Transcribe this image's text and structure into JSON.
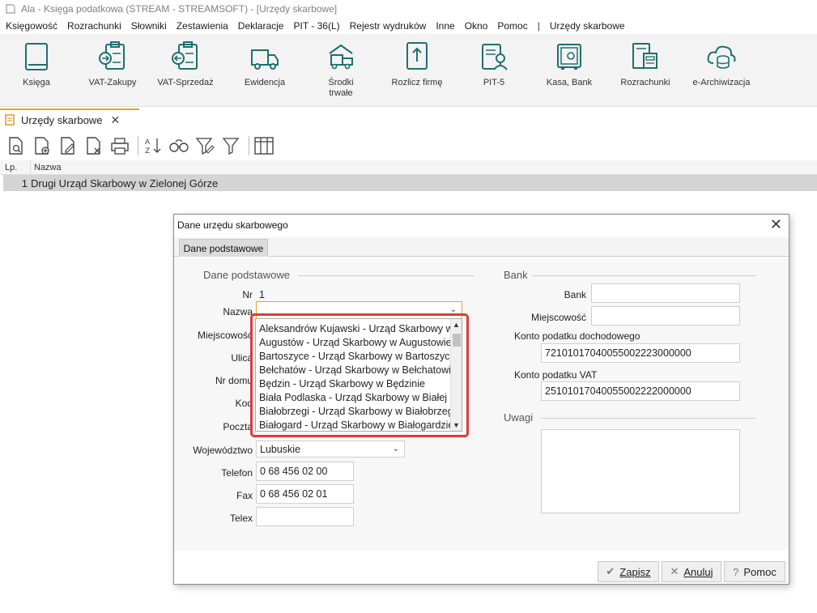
{
  "window": {
    "title": "Ala - Księga podatkowa (STREAM - STREAMSOFT) - [Urzędy skarbowe]"
  },
  "menu": [
    "Księgowość",
    "Rozrachunki",
    "Słowniki",
    "Zestawienia",
    "Deklaracje",
    "PIT - 36(L)",
    "Rejestr wydruków",
    "Inne",
    "Okno",
    "Pomoc",
    "|",
    "Urzędy skarbowe"
  ],
  "ribbon": [
    {
      "label": "Księga",
      "icon": "book-icon"
    },
    {
      "label": "VAT-Zakupy",
      "icon": "vat-purchase-icon"
    },
    {
      "label": "VAT-Sprzedaż",
      "icon": "vat-sales-icon"
    },
    {
      "label": "Ewidencja",
      "icon": "truck-icon"
    },
    {
      "label": "Środki trwałe",
      "icon": "fixed-assets-icon"
    },
    {
      "label": "Rozlicz firmę",
      "icon": "upload-document-icon"
    },
    {
      "label": "PIT-5",
      "icon": "person-document-icon"
    },
    {
      "label": "Kasa, Bank",
      "icon": "safe-icon"
    },
    {
      "label": "Rozrachunki",
      "icon": "settlements-icon"
    },
    {
      "label": "e-Archiwizacja",
      "icon": "cloud-database-icon"
    }
  ],
  "doc_tab": {
    "label": "Urzędy skarbowe",
    "close": "✕"
  },
  "grid": {
    "headers": {
      "lp": "Lp.",
      "name": "Nazwa"
    },
    "rows": [
      {
        "lp": "1",
        "name": "Drugi Urząd Skarbowy w Zielonej Górze"
      }
    ]
  },
  "dialog": {
    "title": "Dane urzędu skarbowego",
    "close": "✕",
    "tab": "Dane podstawowe",
    "left_group": "Dane podstawowe",
    "right_group": "Bank",
    "notes_group": "Uwagi",
    "labels": {
      "nr": "Nr",
      "nazwa": "Nazwa",
      "miejscowosc": "Miejscowość",
      "ulica": "Ulica",
      "nr_domu": "Nr domu",
      "kod": "Kod",
      "poczta": "Poczta",
      "wojewodztwo": "Województwo",
      "telefon": "Telefon",
      "fax": "Fax",
      "telex": "Telex",
      "bank": "Bank",
      "bank_miejscowosc": "Miejscowość",
      "konto_doch": "Konto podatku dochodowego",
      "konto_vat": "Konto podatku VAT"
    },
    "values": {
      "nr": "1",
      "nazwa": "",
      "wojewodztwo": "Lubuskie",
      "telefon": "0 68 456 02 00",
      "fax": "0 68 456 02 01",
      "telex": "",
      "bank": "",
      "bank_miejscowosc": "",
      "konto_doch": "72101017040055002223000000",
      "konto_vat": "25101017040055002222000000"
    },
    "dropdown_items": [
      "Aleksandrów Kujawski - Urząd Skarbowy w Aleksandrowie Kujawskim",
      "Augustów - Urząd Skarbowy w Augustowie",
      "Bartoszyce - Urząd Skarbowy w Bartoszycach",
      "Bełchatów - Urząd Skarbowy w Bełchatowie",
      "Będzin - Urząd Skarbowy w Będzinie",
      "Biała Podlaska - Urząd Skarbowy w Białej Podlaskiej",
      "Białobrzegi - Urząd Skarbowy w Białobrzegach",
      "Białogard - Urząd Skarbowy w Białogardzie"
    ],
    "buttons": {
      "save": "Zapisz",
      "cancel": "Anuluj",
      "help": "Pomoc"
    }
  },
  "colors": {
    "accent": "#f0a020",
    "highlight": "#e03a3a",
    "row_selected": "#d4d4d4"
  }
}
